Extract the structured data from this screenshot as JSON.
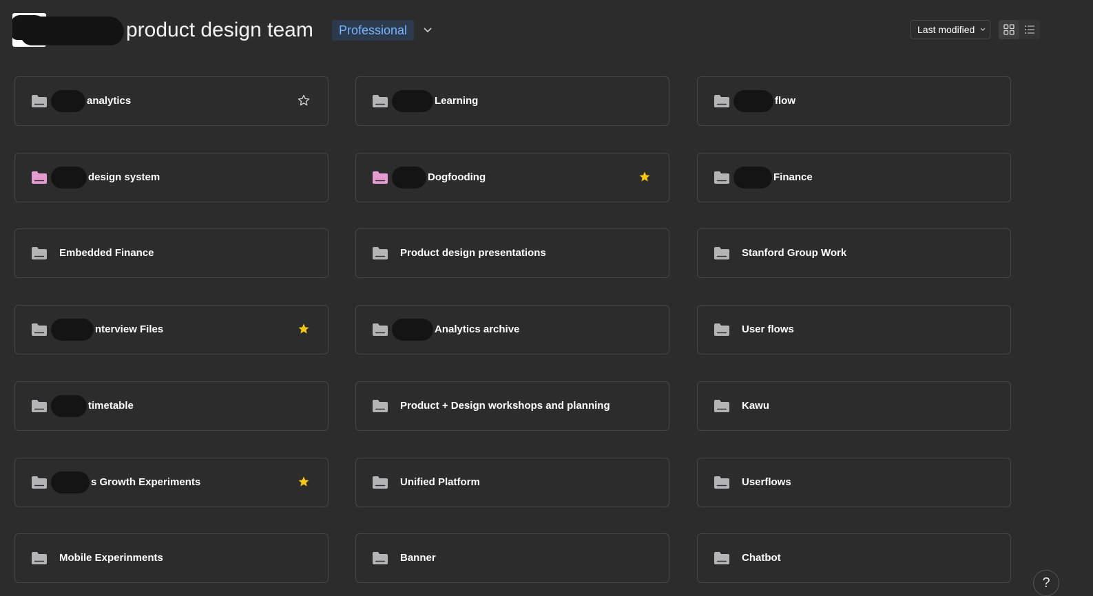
{
  "header": {
    "team_name": "product design team",
    "plan_badge": "Professional",
    "sort_label": "Last modified"
  },
  "colors": {
    "background": "#2c2c2c",
    "card_border": "#464646",
    "folder_default": "#b3b3b8",
    "folder_pink": "#e59ad0",
    "star": "#f5c518",
    "badge_text": "#78b4ff",
    "badge_bg": "#2c3a4d"
  },
  "folders": [
    {
      "label": "analytics",
      "color": "default",
      "star": "outline",
      "redact_w": 50
    },
    {
      "label": "Learning",
      "color": "default",
      "star": "none",
      "redact_w": 60
    },
    {
      "label": "flow",
      "color": "default",
      "star": "none",
      "redact_w": 58
    },
    {
      "label": "design system",
      "color": "pink",
      "star": "none",
      "redact_w": 52
    },
    {
      "label": "Dogfooding",
      "color": "pink",
      "star": "filled",
      "redact_w": 50
    },
    {
      "label": "Finance",
      "color": "default",
      "star": "none",
      "redact_w": 56
    },
    {
      "label": "Embedded Finance",
      "color": "default",
      "star": "none",
      "redact_w": 0
    },
    {
      "label": "Product design presentations",
      "color": "default",
      "star": "none",
      "redact_w": 0
    },
    {
      "label": "Stanford Group Work",
      "color": "default",
      "star": "none",
      "redact_w": 0
    },
    {
      "label": "nterview Files",
      "color": "default",
      "star": "filled",
      "redact_w": 62
    },
    {
      "label": "Analytics archive",
      "color": "default",
      "star": "none",
      "redact_w": 60
    },
    {
      "label": "User flows",
      "color": "default",
      "star": "none",
      "redact_w": 0
    },
    {
      "label": "timetable",
      "color": "default",
      "star": "none",
      "redact_w": 52
    },
    {
      "label": "Product + Design workshops and planning",
      "color": "default",
      "star": "none",
      "redact_w": 0
    },
    {
      "label": "Kawu",
      "color": "default",
      "star": "none",
      "redact_w": 0
    },
    {
      "label": "s Growth Experiments",
      "color": "default",
      "star": "filled",
      "redact_w": 56
    },
    {
      "label": "Unified Platform",
      "color": "default",
      "star": "none",
      "redact_w": 0
    },
    {
      "label": "Userflows",
      "color": "default",
      "star": "none",
      "redact_w": 0
    },
    {
      "label": "Mobile Experinments",
      "color": "default",
      "star": "none",
      "redact_w": 0
    },
    {
      "label": "Banner",
      "color": "default",
      "star": "none",
      "redact_w": 0
    },
    {
      "label": "Chatbot",
      "color": "default",
      "star": "none",
      "redact_w": 0
    }
  ],
  "help": {
    "label": "?"
  }
}
